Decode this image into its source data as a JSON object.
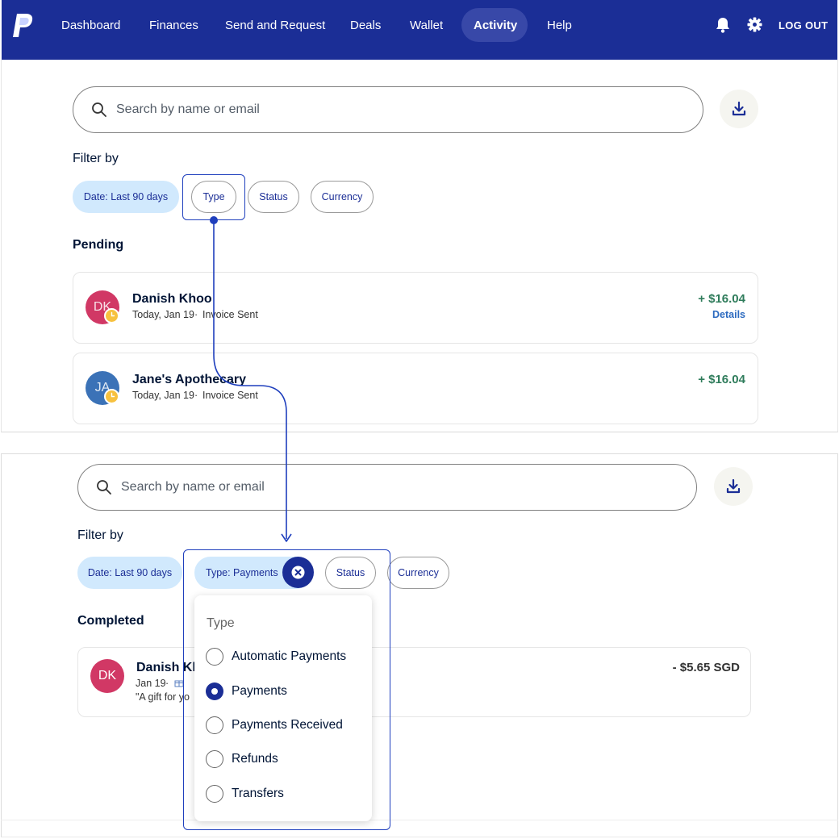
{
  "nav": {
    "items": [
      "Dashboard",
      "Finances",
      "Send and Request",
      "Deals",
      "Wallet",
      "Activity",
      "Help"
    ],
    "active": "Activity",
    "logout": "LOG OUT",
    "icons": [
      "paypal-logo",
      "bell-icon",
      "gear-icon"
    ],
    "bg_color": "#1b2e96"
  },
  "top": {
    "search_placeholder": "Search by name or email",
    "filter_label": "Filter by",
    "chips": [
      "Date: Last 90 days",
      "Type",
      "Status",
      "Currency"
    ],
    "section_title": "Pending",
    "transactions": [
      {
        "initials": "DK",
        "name": "Danish Khoo",
        "date": "Today, Jan 19",
        "separator": "·",
        "type": "Invoice Sent",
        "amount": "+ $16.04",
        "link": "Details",
        "avatar_color": "#d13865"
      },
      {
        "initials": "JA",
        "name": "Jane's Apothecary",
        "date": "Today, Jan 19",
        "separator": "·",
        "type": "Invoice Sent",
        "amount": "+ $16.04",
        "avatar_color": "#3b72b7"
      }
    ]
  },
  "bottom": {
    "search_placeholder": "Search by name or email",
    "filter_label": "Filter by",
    "chips": [
      "Date: Last 90 days",
      "Type: Payments",
      "Status",
      "Currency"
    ],
    "section_title": "Completed",
    "transaction": {
      "initials": "DK",
      "name": "Danish Kh",
      "date": "Jan 19",
      "separator": "·",
      "line3": "\"A gift for yo",
      "amount": "- $5.65 SGD",
      "avatar_color": "#d13865"
    },
    "dropdown": {
      "title": "Type",
      "options": [
        "Automatic Payments",
        "Payments",
        "Payments Received",
        "Refunds",
        "Transfers"
      ],
      "selected": "Payments"
    }
  },
  "accent_color": "#1f3fbd"
}
